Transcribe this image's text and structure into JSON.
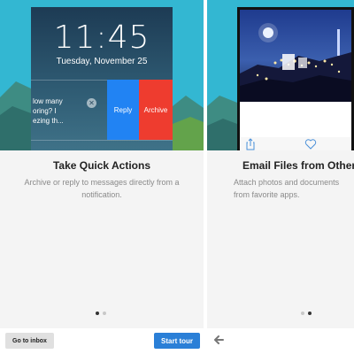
{
  "slides": [
    {
      "lock_screen": {
        "time": "11:45",
        "date": "Tuesday, November 25",
        "notification_lines": [
          "low many",
          "oring? I",
          "ezing th..."
        ],
        "reply_label": "Reply",
        "archive_label": "Archive"
      },
      "title": "Take Quick Actions",
      "description": "Archive or reply to messages directly from a notification."
    },
    {
      "title": "Email Files from Other A",
      "description": "Attach photos and documents from favorite apps."
    }
  ],
  "pagination": {
    "total": 2
  },
  "bottom_bar": {
    "inbox_label": "Go to inbox",
    "tour_label": "Start tour"
  },
  "colors": {
    "sky": "#33b7d2",
    "reply": "#2183f3",
    "archive": "#ee3c2f",
    "primary_button": "#2a7fd7"
  },
  "icons": [
    "clear-icon",
    "share-icon",
    "heart-icon",
    "back-arrow-icon"
  ]
}
